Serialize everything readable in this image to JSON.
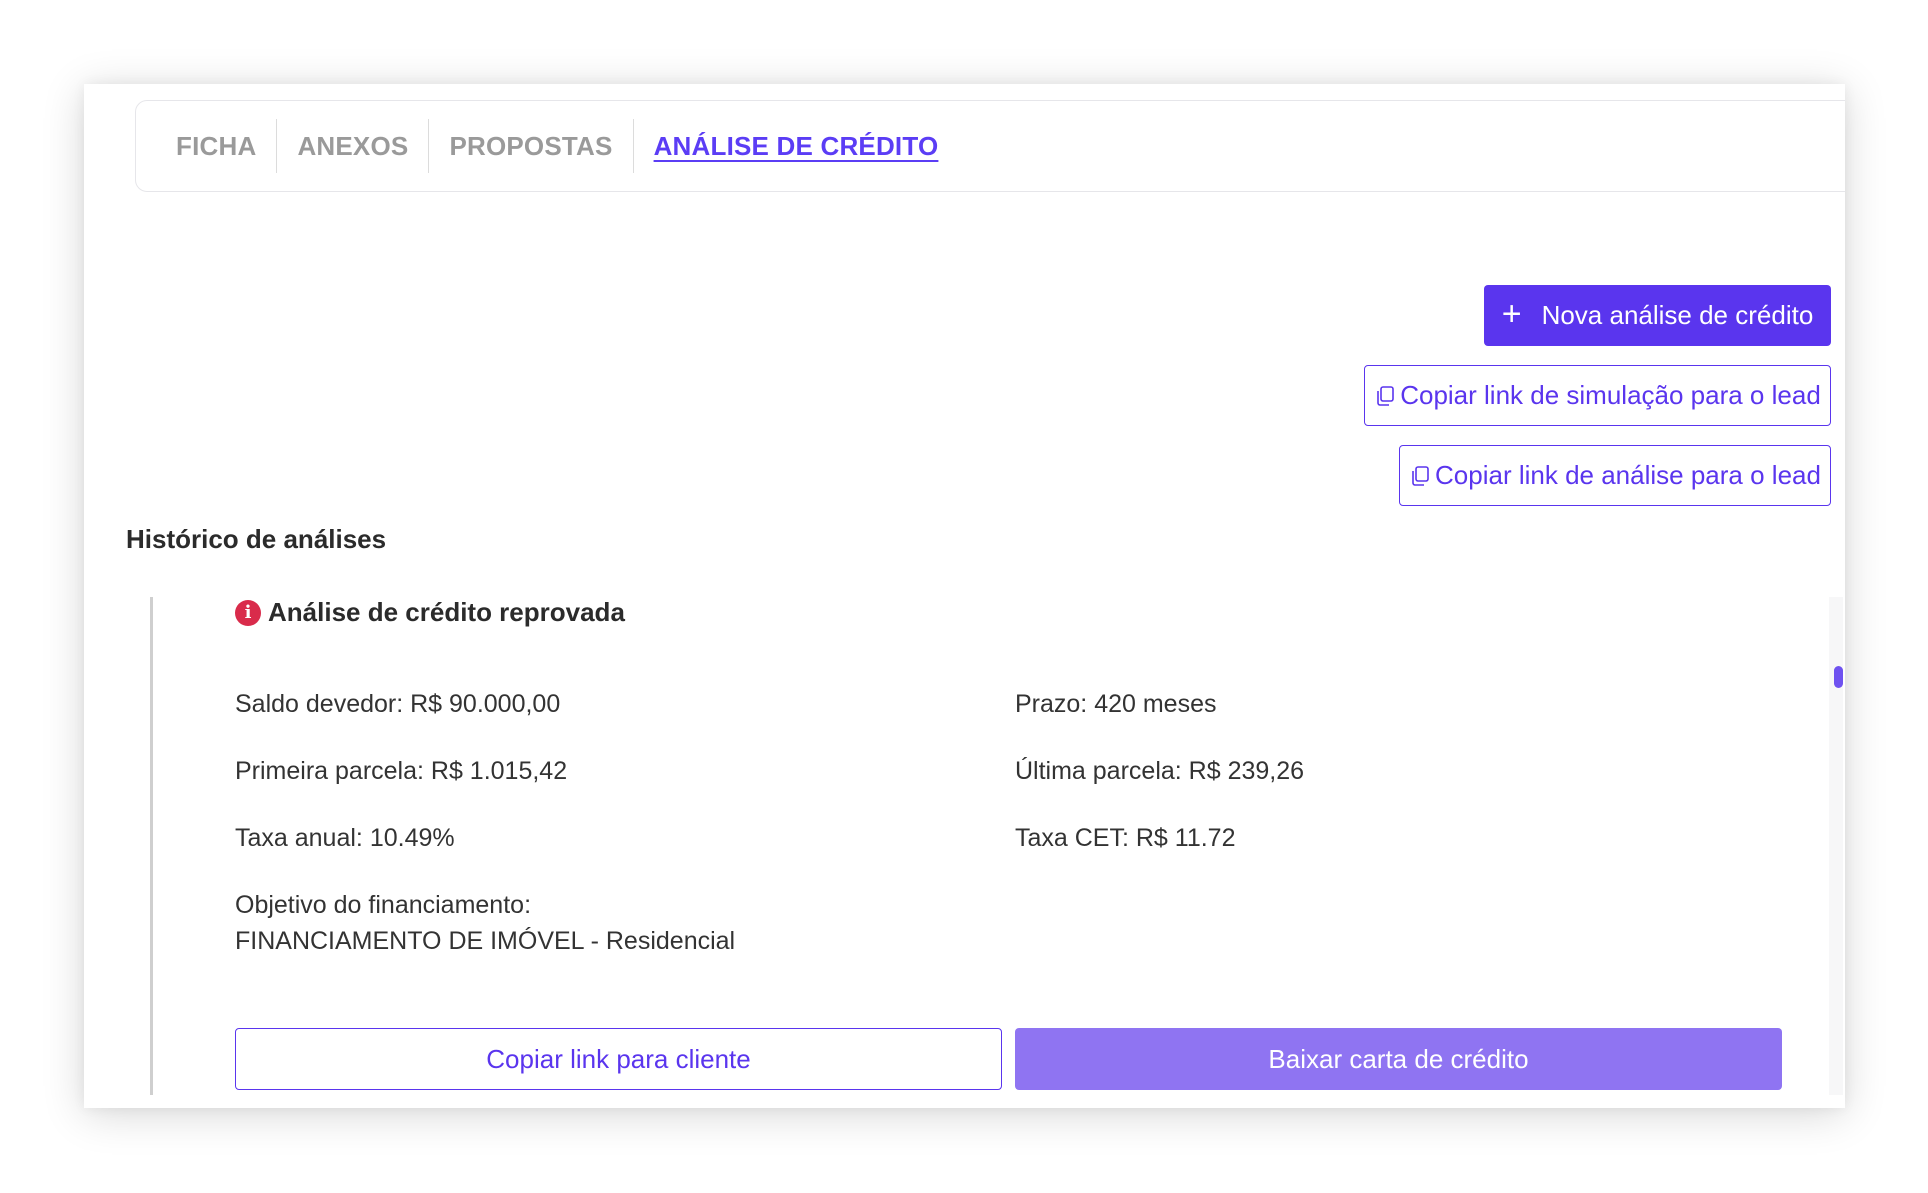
{
  "tabs": [
    {
      "label": "FICHA"
    },
    {
      "label": "ANEXOS"
    },
    {
      "label": "PROPOSTAS"
    },
    {
      "label": "ANÁLISE DE CRÉDITO",
      "active": true
    }
  ],
  "actions": {
    "new_analysis": {
      "icon": "plus-icon",
      "label": "Nova análise de crédito"
    },
    "copy_simulation_link": {
      "icon": "copy-icon",
      "label": "Copiar link de simulação para o lead"
    },
    "copy_analysis_link": {
      "icon": "copy-icon",
      "label": "Copiar link de análise para o lead"
    }
  },
  "history": {
    "title": "Histórico de análises",
    "entry": {
      "status_icon": "info-error-icon",
      "status": "Análise de crédito reprovada",
      "saldo_devedor": "Saldo devedor: R$ 90.000,00",
      "prazo": "Prazo: 420 meses",
      "primeira_parcela": "Primeira parcela: R$ 1.015,42",
      "ultima_parcela": "Última parcela: R$ 239,26",
      "taxa_anual": "Taxa anual: 10.49%",
      "taxa_cet": "Taxa CET: R$ 11.72",
      "objetivo_label": "Objetivo do financiamento:",
      "objetivo_value": "FINANCIAMENTO DE IMÓVEL - Residencial",
      "copy_client_link": "Copiar link para cliente",
      "download_letter": "Baixar carta de crédito"
    }
  },
  "colors": {
    "accent": "#5a35ee",
    "accent_light": "#8f74f2",
    "error": "#d92b4b",
    "tab_inactive": "#9a9a9a"
  }
}
